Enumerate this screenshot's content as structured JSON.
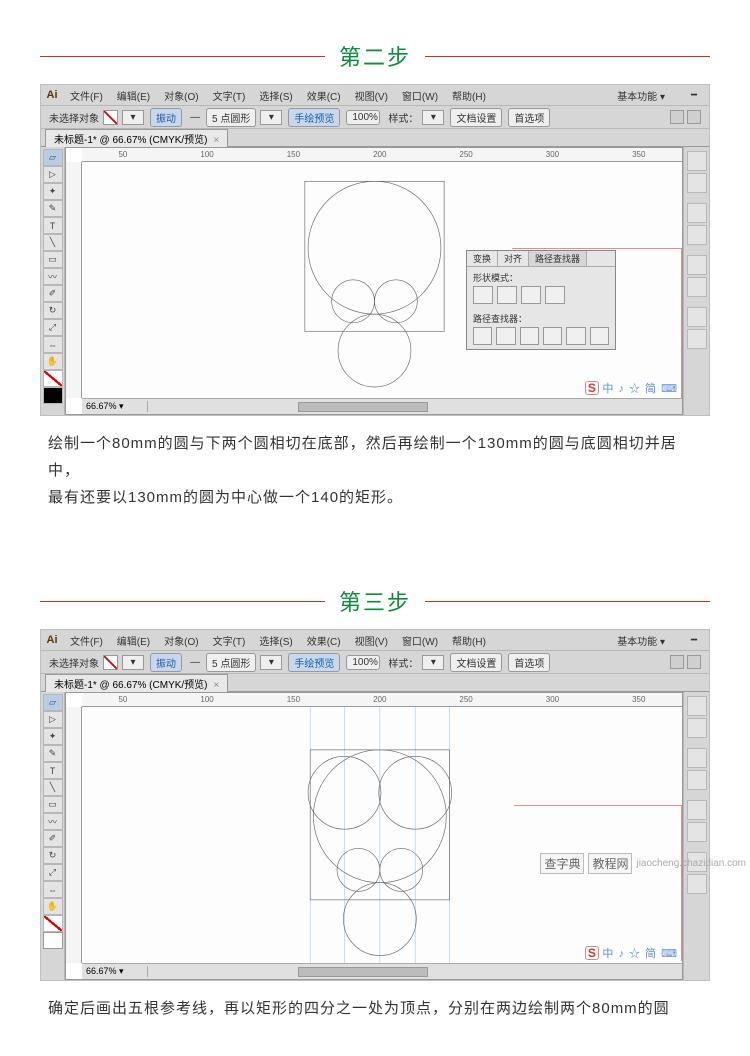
{
  "steps": {
    "s2": {
      "title": "第二步",
      "caption_l1": "绘制一个80mm的圆与下两个圆相切在底部，然后再绘制一个130mm的圆与底圆相切并居中，",
      "caption_l2": "最有还要以130mm的圆为中心做一个140的矩形。"
    },
    "s3": {
      "title": "第三步",
      "caption_l1": "确定后画出五根参考线，再以矩形的四分之一处为顶点，分别在两边绘制两个80mm的圆"
    }
  },
  "ai": {
    "logo": "Ai",
    "menu": [
      "文件(F)",
      "编辑(E)",
      "对象(O)",
      "文字(T)",
      "选择(S)",
      "效果(C)",
      "视图(V)",
      "窗口(W)",
      "帮助(H)"
    ],
    "right_label": "基本功能 ▾",
    "dash": "━",
    "ctrl": {
      "noselect": "未选择对象",
      "active": "振动",
      "stroke_val": "5 点圆形",
      "mode": "手绘预览",
      "opacity": "100%",
      "opacity_lbl": "样式：",
      "docset": "文档设置",
      "pref": "首选项"
    },
    "doc_tab": "未标题-1* @ 66.67% (CMYK/预览)",
    "zoom": "66.67% ▾",
    "ruler_marks": [
      "50",
      "100",
      "150",
      "200",
      "250",
      "300",
      "350"
    ],
    "pathfinder": {
      "tabs": [
        "变换",
        "对齐",
        "路径查找器"
      ],
      "sect1": "形状模式：",
      "sect2": "路径查找器："
    },
    "sg_brand": "S",
    "sg_text": "中 ♪ ☆ 简 ⌨"
  },
  "watermark": {
    "box1": "查字典",
    "box2": "教程网",
    "url": "jiaocheng.chazidian.com"
  }
}
